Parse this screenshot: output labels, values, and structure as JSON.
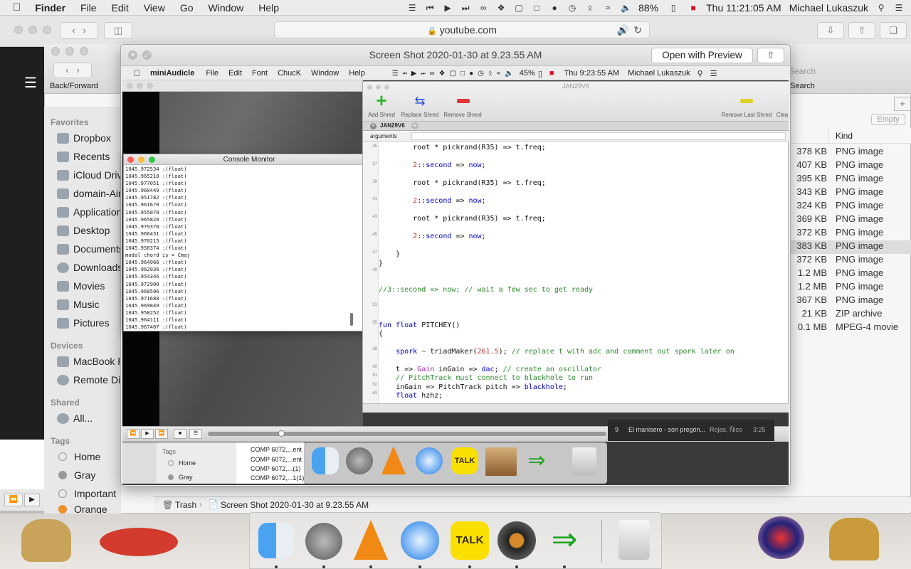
{
  "menubar": {
    "app": "Finder",
    "items": [
      "File",
      "Edit",
      "View",
      "Go",
      "Window",
      "Help"
    ],
    "battery": "88%",
    "clock": "Thu 11:21:05 AM",
    "user": "Michael Lukaszuk"
  },
  "safari": {
    "url": "youtube.com"
  },
  "finder": {
    "back_forward_label": "Back/Forward",
    "search_placeholder": "Search",
    "search_label": "Search",
    "empty_label": "Empty",
    "kind_header": "Kind",
    "sidebar": {
      "favorites_header": "Favorites",
      "favorites": [
        "Dropbox",
        "Recents",
        "iCloud Drive",
        "domain-Air",
        "Applications",
        "Desktop",
        "Documents",
        "Downloads",
        "Movies",
        "Music",
        "Pictures"
      ],
      "devices_header": "Devices",
      "devices": [
        "MacBook Pro",
        "Remote Disc"
      ],
      "shared_header": "Shared",
      "shared": [
        "All..."
      ],
      "tags_header": "Tags",
      "tags": [
        "Home",
        "Gray",
        "Important",
        "Orange"
      ]
    },
    "rows": [
      {
        "size": "378 KB",
        "kind": "PNG image"
      },
      {
        "size": "407 KB",
        "kind": "PNG image"
      },
      {
        "size": "395 KB",
        "kind": "PNG image"
      },
      {
        "size": "343 KB",
        "kind": "PNG image"
      },
      {
        "size": "324 KB",
        "kind": "PNG image"
      },
      {
        "size": "369 KB",
        "kind": "PNG image"
      },
      {
        "size": "372 KB",
        "kind": "PNG image"
      },
      {
        "size": "383 KB",
        "kind": "PNG image"
      },
      {
        "size": "372 KB",
        "kind": "PNG image"
      },
      {
        "size": "1.2 MB",
        "kind": "PNG image"
      },
      {
        "size": "1.2 MB",
        "kind": "PNG image"
      },
      {
        "size": "367 KB",
        "kind": "PNG image"
      },
      {
        "size": "21 KB",
        "kind": "ZIP archive"
      },
      {
        "size": "0.1 MB",
        "kind": "MPEG-4 movie"
      }
    ],
    "path": [
      "Trash",
      "Screen Shot 2020-01-30 at 9.23.55 AM"
    ]
  },
  "preview": {
    "title": "Screen Shot 2020-01-30 at 9.23.55 AM",
    "open_button": "Open with Preview"
  },
  "inner": {
    "menubar": {
      "app": "miniAudicle",
      "items": [
        "File",
        "Edit",
        "Font",
        "ChucK",
        "Window",
        "Help"
      ],
      "battery": "45%",
      "clock": "Thu 9:23:55 AM",
      "user": "Michael Lukaszuk"
    },
    "console": {
      "title": "Console Monitor",
      "lines": [
        "1045.972534 :(float)",
        "1045.965210 :(float)",
        "1045.977051 :(float)",
        "1045.960449 :(float)",
        "1045.951782 :(float)",
        "1045.961670 :(float)",
        "1045.955078 :(float)",
        "1045.965820 :(float)",
        "1045.979370 :(float)",
        "1045.966431 :(float)",
        "1045.970215 :(float)",
        "1045.958374 :(float)",
        "modal chord is = Cmaj",
        "1045.964966 :(float)",
        "1045.962036 :(float)",
        "1045.954346 :(float)",
        "1045.972900 :(float)",
        "1045.968506 :(float)",
        "1045.971680 :(float)",
        "1045.969849 :(float)",
        "1045.958252 :(float)",
        "1045.964111 :(float)",
        "1045.967407 :(float)"
      ]
    },
    "editor": {
      "window_title": "JAN29V6",
      "tab": "JAN29V6",
      "arguments_label": "arguments",
      "toolbar": {
        "add": "Add Shred",
        "replace": "Replace Shred",
        "remove": "Remove Shred",
        "remove_last": "Remove Last Shred",
        "clear": "Clea"
      },
      "line_numbers": [
        "35",
        "",
        "37",
        "",
        "39",
        "",
        "41",
        "",
        "43",
        "",
        "45",
        "",
        "47",
        "",
        "49",
        "",
        "",
        "",
        "53",
        "",
        "55",
        "",
        "",
        "58",
        "",
        "60",
        "61",
        "62",
        "63"
      ]
    },
    "song": {
      "track": "9",
      "title": "El manisero - son pregón...",
      "artist": "Rojas, Ñico",
      "time": "3:25"
    },
    "finder_tags": {
      "header": "Tags",
      "items": [
        "Home",
        "Gray"
      ]
    },
    "files": [
      "COMP 6072,...ent",
      "COMP 6072,...ent",
      "COMP 6072,...(1)",
      "COMP 6072,...1(1)"
    ]
  }
}
